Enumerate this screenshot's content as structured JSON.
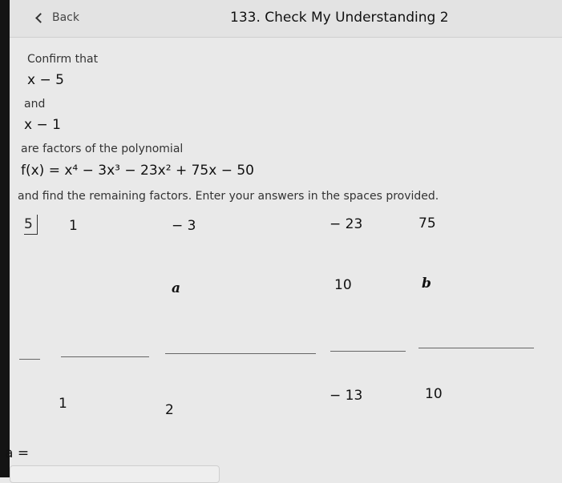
{
  "header": {
    "back_label": "Back",
    "title": "133. Check My Understanding 2"
  },
  "problem": {
    "line1": "Confirm that",
    "expr1": "x − 5",
    "and": "and",
    "expr2": "x − 1",
    "line2": "are factors of the polynomial",
    "poly": "f(x) = x⁴ − 3x³ − 23x² + 75x − 50",
    "instruction": "and find the remaining factors. Enter your answers in the spaces provided."
  },
  "synthetic": {
    "divisor": "5",
    "row1": [
      "1",
      "− 3",
      "− 23",
      "75"
    ],
    "row2": [
      "a",
      "10",
      "b"
    ],
    "row3": [
      "1",
      "2",
      "− 13",
      "10"
    ]
  },
  "answer": {
    "label": "a ="
  }
}
